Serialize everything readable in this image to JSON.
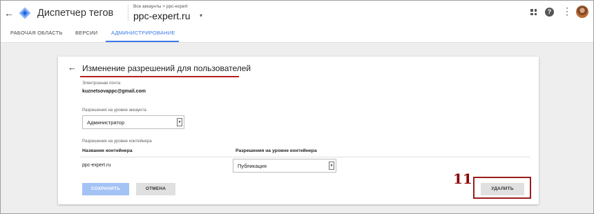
{
  "topbar": {
    "back_icon": "arrow-left-icon",
    "logo_icon": "tag-manager-logo",
    "app_title": "Диспетчер тегов",
    "breadcrumb": "Все аккаунты > ppc-expert",
    "container_name": "ppc-expert.ru",
    "container_caret": "▾",
    "apps_icon": "apps-grid-icon",
    "help_icon_glyph": "?",
    "more_icon_glyph": "⋮"
  },
  "tabs": [
    {
      "label": "РАБОЧАЯ ОБЛАСТЬ"
    },
    {
      "label": "ВЕРСИИ"
    },
    {
      "label": "АДМИНИСТРИРОВАНИЕ"
    }
  ],
  "colors": {
    "accent": "#3b78e7",
    "annotation": "#9b1c1c"
  },
  "card": {
    "back_glyph": "←",
    "title": "Изменение разрешений для пользователей",
    "email_label": "Электронная почта",
    "email_value": "kuznetsovappc@gmail.com",
    "account_permissions_label": "Разрешения на уровне аккаунта",
    "account_permission_value": "Администратор",
    "container_permissions_label": "Разрешения на уровне контейнера",
    "table": {
      "headers": [
        "Название контейнера",
        "Разрешения на уровне контейнера"
      ],
      "rows": [
        {
          "container": "ppc-expert.ru",
          "permission": "Публикация"
        }
      ]
    },
    "select_arrow_glyph": "▾",
    "buttons": {
      "save": "СОХРАНИТЬ",
      "cancel": "ОТМЕНА",
      "delete": "УДАЛИТЬ"
    }
  },
  "annotation": {
    "step_number": "11"
  }
}
